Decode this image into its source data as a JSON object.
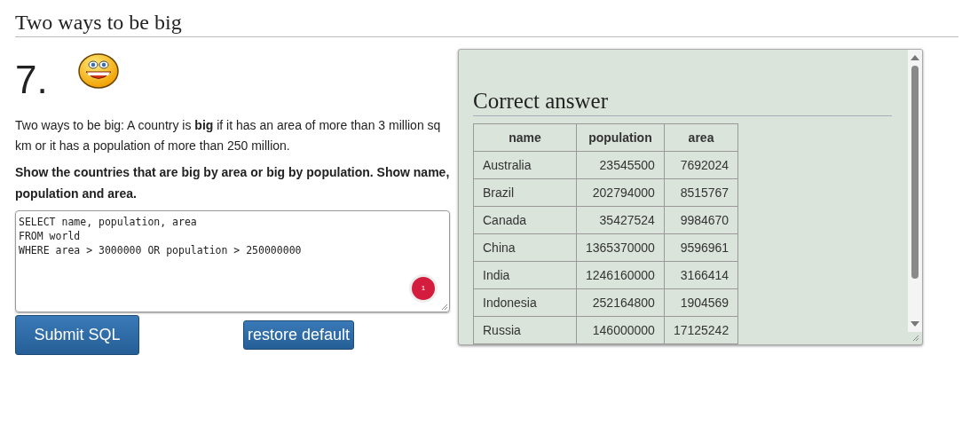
{
  "page_title": "Two ways to be big",
  "question": {
    "number": "7.",
    "intro": "Two ways to be big: A country is **big** if it has an area of more than 3 million sq km or it has a population of more than 250 million.",
    "task": "Show the countries that are big by area or big by population. Show name, population and area.",
    "sql_lines": [
      "SELECT name, population, area",
      "FROM world",
      "WHERE area > 3000000 OR population > 250000000"
    ],
    "grammar_badge": "1",
    "buttons": [
      {
        "label": "Submit SQL",
        "kind": "primary"
      },
      {
        "label": "restore default",
        "kind": "secondary"
      }
    ]
  },
  "answer": {
    "title": "Correct answer",
    "table": {
      "columns": [
        "name",
        "population",
        "area"
      ],
      "rows": [
        [
          "Australia",
          "23545500",
          "7692024"
        ],
        [
          "Brazil",
          "202794000",
          "8515767"
        ],
        [
          "Canada",
          "35427524",
          "9984670"
        ],
        [
          "China",
          "1365370000",
          "9596961"
        ],
        [
          "India",
          "1246160000",
          "3166414"
        ],
        [
          "Indonesia",
          "252164800",
          "1904569"
        ],
        [
          "Russia",
          "146000000",
          "17125242"
        ]
      ]
    }
  }
}
